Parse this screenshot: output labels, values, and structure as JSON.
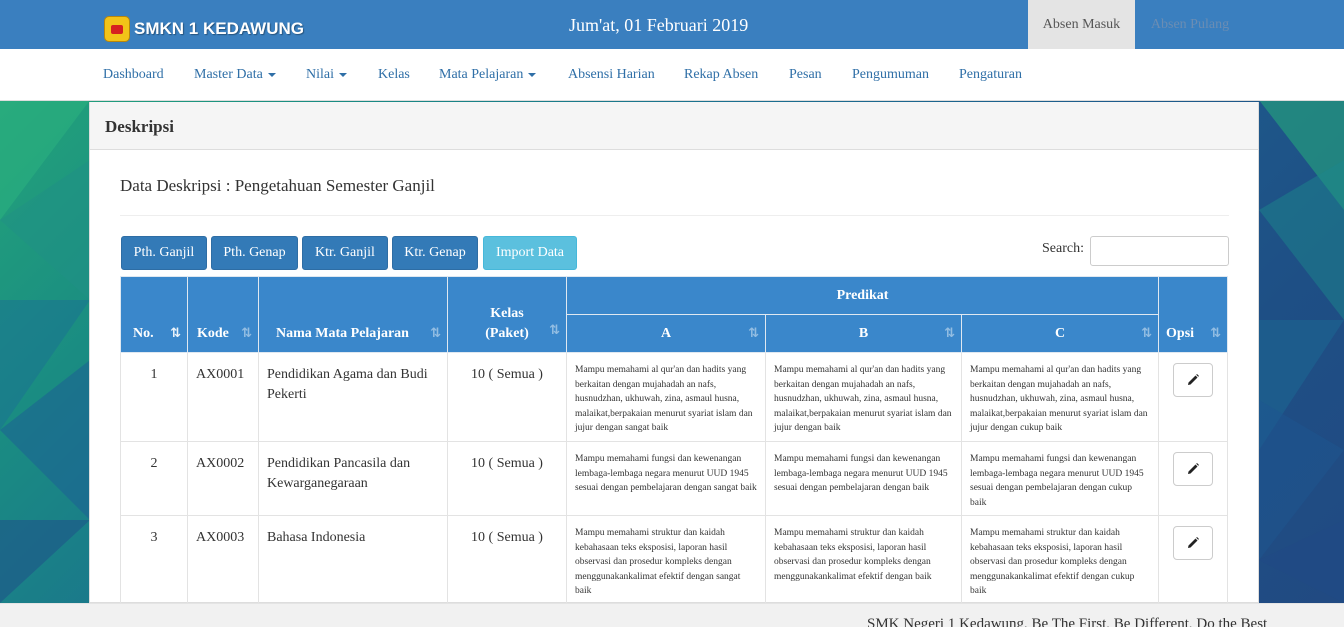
{
  "brand": {
    "name": "SMKN 1 KEDAWUNG"
  },
  "topbar": {
    "date": "Jum'at, 01 Februari 2019",
    "absen_masuk": "Absen Masuk",
    "absen_pulang": "Absen Pulang"
  },
  "nav": {
    "dashboard": "Dashboard",
    "master_data": "Master Data",
    "nilai": "Nilai",
    "kelas": "Kelas",
    "mata_pelajaran": "Mata Pelajaran",
    "absensi_harian": "Absensi Harian",
    "rekap_absen": "Rekap Absen",
    "pesan": "Pesan",
    "pengumuman": "Pengumuman",
    "pengaturan": "Pengaturan"
  },
  "panel": {
    "heading": "Deskripsi",
    "title": "Data Deskripsi : Pengetahuan Semester Ganjil"
  },
  "buttons": {
    "pth_ganjil": "Pth. Ganjil",
    "pth_genap": "Pth. Genap",
    "ktr_ganjil": "Ktr. Ganjil",
    "ktr_genap": "Ktr. Genap",
    "import": "Import Data"
  },
  "search": {
    "label": "Search:",
    "value": ""
  },
  "table": {
    "headers": {
      "no": "No.",
      "kode": "Kode",
      "nama": "Nama Mata Pelajaran",
      "kelas_line1": "Kelas",
      "kelas_line2": "(Paket)",
      "predikat": "Predikat",
      "a": "A",
      "b": "B",
      "c": "C",
      "opsi": "Opsi"
    },
    "rows": [
      {
        "no": "1",
        "kode": "AX0001",
        "nama": "Pendidikan Agama dan Budi Pekerti",
        "kelas": "10 ( Semua )",
        "a": "Mampu memahami al qur'an dan hadits yang berkaitan dengan mujahadah an nafs, husnudzhan, ukhuwah, zina, asmaul husna, malaikat,berpakaian menurut syariat islam dan jujur dengan sangat baik",
        "b": "Mampu memahami al qur'an dan hadits yang berkaitan dengan mujahadah an nafs, husnudzhan, ukhuwah, zina, asmaul husna, malaikat,berpakaian menurut syariat islam dan jujur dengan baik",
        "c": "Mampu memahami al qur'an dan hadits yang berkaitan dengan mujahadah an nafs, husnudzhan, ukhuwah, zina, asmaul husna, malaikat,berpakaian menurut syariat islam dan jujur dengan cukup baik"
      },
      {
        "no": "2",
        "kode": "AX0002",
        "nama": "Pendidikan Pancasila dan Kewarganegaraan",
        "kelas": "10 ( Semua )",
        "a": "Mampu memahami fungsi dan kewenangan lembaga-lembaga negara menurut UUD 1945 sesuai dengan pembelajaran dengan sangat baik",
        "b": "Mampu memahami fungsi dan kewenangan lembaga-lembaga negara menurut UUD 1945 sesuai dengan pembelajaran dengan baik",
        "c": "Mampu memahami fungsi dan kewenangan lembaga-lembaga negara menurut UUD 1945 sesuai dengan pembelajaran dengan cukup baik"
      },
      {
        "no": "3",
        "kode": "AX0003",
        "nama": "Bahasa Indonesia",
        "kelas": "10 ( Semua )",
        "a": "Mampu memahami struktur dan kaidah kebahasaan teks eksposisi, laporan hasil observasi dan prosedur kompleks dengan menggunakankalimat efektif dengan sangat baik",
        "b": "Mampu memahami struktur dan kaidah kebahasaan teks eksposisi, laporan hasil observasi dan prosedur kompleks dengan menggunakankalimat efektif dengan baik",
        "c": "Mampu memahami struktur dan kaidah kebahasaan teks eksposisi, laporan hasil observasi dan prosedur kompleks dengan menggunakankalimat efektif dengan cukup baik"
      }
    ]
  },
  "footer": {
    "text": "SMK Negeri 1 Kedawung, Be The First, Be Different, Do the Best"
  }
}
